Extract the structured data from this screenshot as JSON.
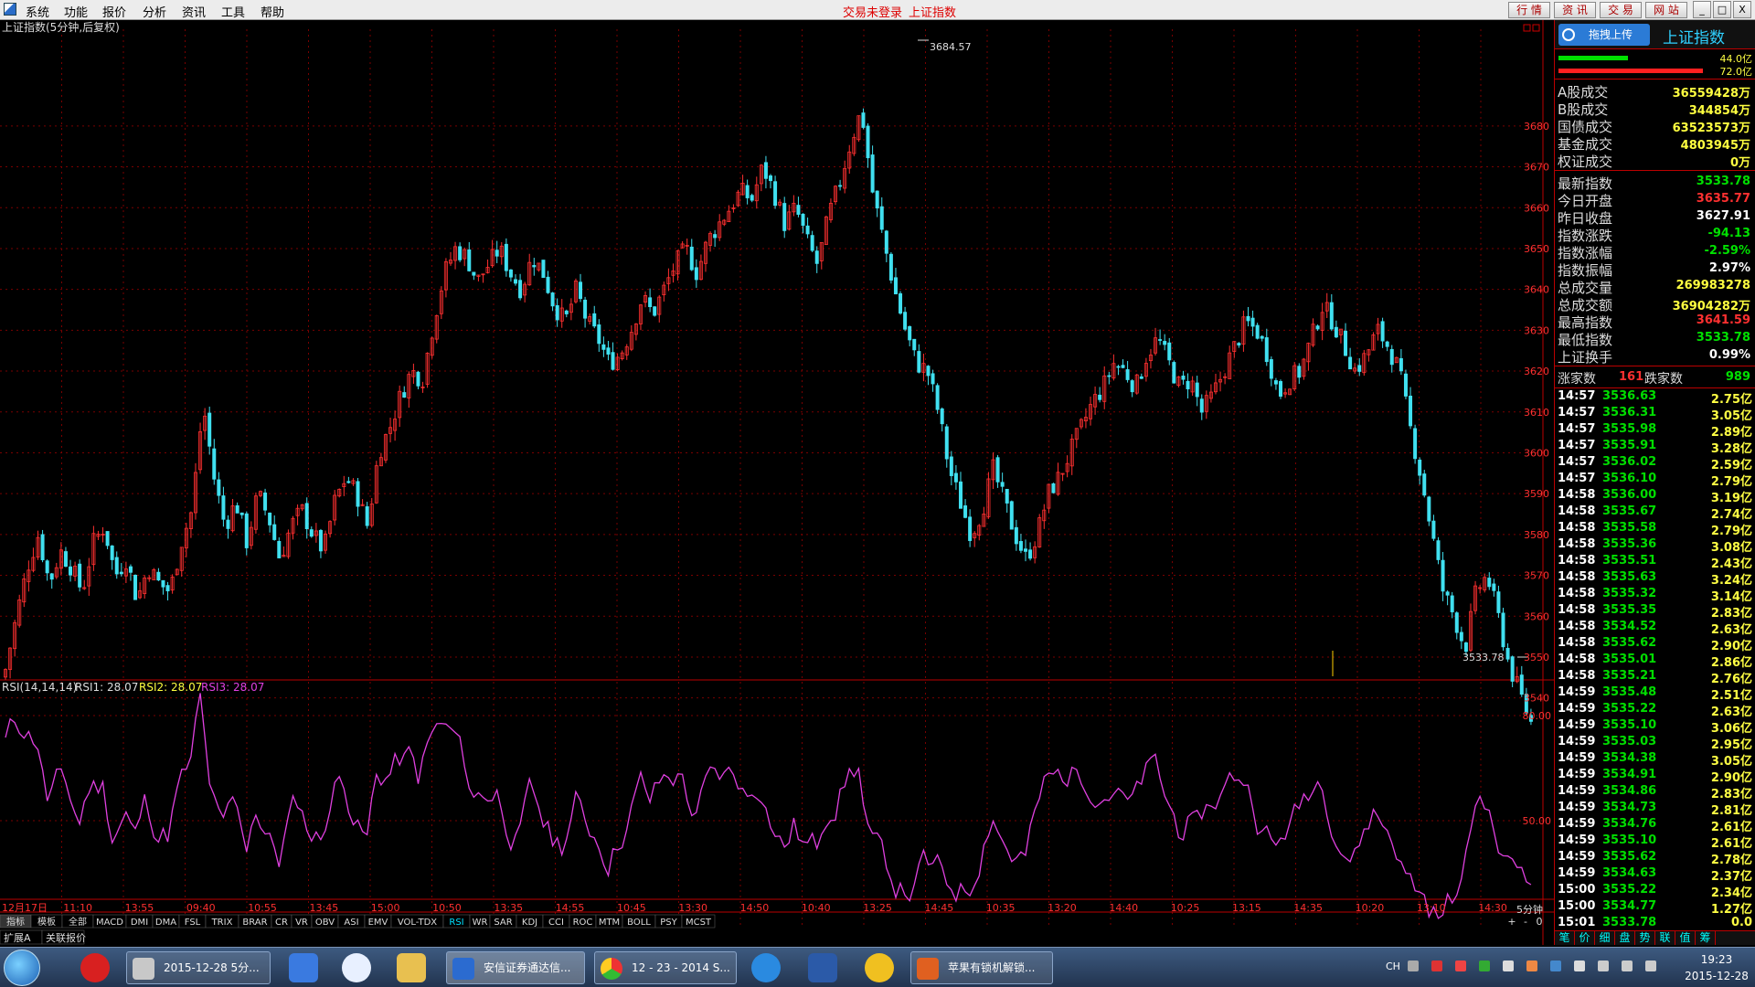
{
  "menu": {
    "items": [
      "系统",
      "功能",
      "报价",
      "分析",
      "资讯",
      "工具",
      "帮助"
    ],
    "login_status": "交易未登录",
    "current_index": "上证指数",
    "right_buttons": [
      "行 情",
      "资 讯",
      "交 易",
      "网 站"
    ],
    "window_controls": [
      "_",
      "□",
      "X"
    ]
  },
  "chart": {
    "title": "上证指数(5分钟,后复权)",
    "high_label": "3684.57",
    "low_label": "3533.78",
    "y_ticks": [
      "3680",
      "3670",
      "3660",
      "3650",
      "3640",
      "3630",
      "3620",
      "3610",
      "3600",
      "3590",
      "3580",
      "3570",
      "3560",
      "3550",
      "3540"
    ],
    "rsi_legend": {
      "name": "RSI(14,14,14)",
      "rsi1": "RSI1: 28.07",
      "rsi2": "RSI2: 28.07",
      "rsi3": "RSI3: 28.07"
    },
    "rsi_ticks": [
      "80.00",
      "50.00"
    ],
    "x_labels": [
      "12月17日",
      "11:10",
      "13:55",
      "09:40",
      "10:55",
      "13:45",
      "15:00",
      "10:50",
      "13:35",
      "14:55",
      "10:45",
      "13:30",
      "14:50",
      "10:40",
      "13:25",
      "14:45",
      "10:35",
      "13:20",
      "14:40",
      "10:25",
      "13:15",
      "14:35",
      "10:20",
      "13:10",
      "14:30"
    ],
    "period": "5分钟",
    "indicator_tabs": [
      "指标",
      "模板",
      "全部",
      "MACD",
      "DMI",
      "DMA",
      "FSL",
      "TRIX",
      "BRAR",
      "CR",
      "VR",
      "OBV",
      "ASI",
      "EMV",
      "VOL-TDX",
      "RSI",
      "WR",
      "SAR",
      "KDJ",
      "CCI",
      "ROC",
      "MTM",
      "BOLL",
      "PSY",
      "MCST"
    ],
    "active_tab": "RSI",
    "scroll_controls": [
      "+",
      "-",
      "0"
    ],
    "bottom_tabs": [
      "扩展A",
      "关联报价"
    ],
    "colors": {
      "up": "#ff3030",
      "down": "#40e0f0",
      "rsi": "#e040e0",
      "grid": "#7a0000"
    }
  },
  "chart_data": [
    {
      "type": "candlestick",
      "title": "上证指数(5分钟,后复权)",
      "ylim": [
        3533.78,
        3684.57
      ],
      "high": 3684.57,
      "low": 3533.78,
      "close_path": [
        3547,
        3560,
        3572,
        3580,
        3568,
        3576,
        3572,
        3566,
        3578,
        3582,
        3570,
        3574,
        3564,
        3572,
        3568,
        3566,
        3578,
        3586,
        3612,
        3594,
        3582,
        3588,
        3578,
        3590,
        3584,
        3574,
        3582,
        3586,
        3580,
        3576,
        3588,
        3594,
        3590,
        3582,
        3600,
        3606,
        3614,
        3620,
        3618,
        3632,
        3644,
        3650,
        3648,
        3642,
        3646,
        3650,
        3644,
        3640,
        3648,
        3644,
        3636,
        3632,
        3640,
        3632,
        3628,
        3622,
        3624,
        3630,
        3638,
        3634,
        3640,
        3646,
        3650,
        3644,
        3652,
        3656,
        3660,
        3664,
        3662,
        3670,
        3664,
        3656,
        3660,
        3652,
        3646,
        3658,
        3666,
        3676,
        3684,
        3664,
        3652,
        3640,
        3630,
        3622,
        3620,
        3610,
        3596,
        3588,
        3580,
        3586,
        3596,
        3588,
        3580,
        3574,
        3580,
        3590,
        3594,
        3600,
        3606,
        3612,
        3616,
        3622,
        3620,
        3616,
        3624,
        3628,
        3622,
        3616,
        3618,
        3610,
        3614,
        3620,
        3626,
        3632,
        3630,
        3624,
        3614,
        3618,
        3620,
        3628,
        3636,
        3632,
        3626,
        3620,
        3624,
        3630,
        3626,
        3620,
        3606,
        3594,
        3580,
        3566,
        3560,
        3552,
        3566,
        3570,
        3560,
        3548,
        3541,
        3534
      ],
      "series": [
        {
          "name": "RSI1",
          "ylim": [
            0,
            100
          ]
        }
      ]
    }
  ],
  "panel": {
    "upload_label": "拖拽上传",
    "title": "上证指数",
    "bars": [
      {
        "value": "44.0亿",
        "color": "#00e000"
      },
      {
        "value": "72.0亿",
        "color": "#ff2020"
      }
    ],
    "volumes": [
      {
        "k": "A股成交",
        "v": "36559428万"
      },
      {
        "k": "B股成交",
        "v": "344854万"
      },
      {
        "k": "国债成交",
        "v": "63523573万"
      },
      {
        "k": "基金成交",
        "v": "4803945万"
      },
      {
        "k": "权证成交",
        "v": "0万"
      }
    ],
    "stats": [
      {
        "k": "最新指数",
        "v": "3533.78",
        "c": "#00e000"
      },
      {
        "k": "今日开盘",
        "v": "3635.77",
        "c": "#ff3030"
      },
      {
        "k": "昨日收盘",
        "v": "3627.91",
        "c": "#ffffff"
      },
      {
        "k": "指数涨跌",
        "v": "-94.13",
        "c": "#00e000"
      },
      {
        "k": "指数涨幅",
        "v": "-2.59%",
        "c": "#00e000"
      },
      {
        "k": "指数振幅",
        "v": "2.97%",
        "c": "#ffffff"
      },
      {
        "k": "总成交量",
        "v": "269983278",
        "c": "#ffff40"
      },
      {
        "k": "总成交额",
        "v": "36904282万",
        "c": "#ffff40"
      },
      {
        "k": "最高指数",
        "v": "3641.59",
        "c": "#ff3030"
      },
      {
        "k": "最低指数",
        "v": "3533.78",
        "c": "#00e000"
      },
      {
        "k": "上证换手",
        "v": "0.99%",
        "c": "#ffffff"
      }
    ],
    "breadth": {
      "up_label": "涨家数",
      "up": "161",
      "down_label": "跌家数",
      "down": "989"
    },
    "ticks": [
      [
        "14:57",
        "3536.63",
        "2.75亿"
      ],
      [
        "14:57",
        "3536.31",
        "3.05亿"
      ],
      [
        "14:57",
        "3535.98",
        "2.89亿"
      ],
      [
        "14:57",
        "3535.91",
        "3.28亿"
      ],
      [
        "14:57",
        "3536.02",
        "2.59亿"
      ],
      [
        "14:57",
        "3536.10",
        "2.79亿"
      ],
      [
        "14:58",
        "3536.00",
        "3.19亿"
      ],
      [
        "14:58",
        "3535.67",
        "2.74亿"
      ],
      [
        "14:58",
        "3535.58",
        "2.79亿"
      ],
      [
        "14:58",
        "3535.36",
        "3.08亿"
      ],
      [
        "14:58",
        "3535.51",
        "2.43亿"
      ],
      [
        "14:58",
        "3535.63",
        "3.24亿"
      ],
      [
        "14:58",
        "3535.32",
        "3.14亿"
      ],
      [
        "14:58",
        "3535.35",
        "2.83亿"
      ],
      [
        "14:58",
        "3534.52",
        "2.63亿"
      ],
      [
        "14:58",
        "3535.62",
        "2.90亿"
      ],
      [
        "14:58",
        "3535.01",
        "2.86亿"
      ],
      [
        "14:58",
        "3535.21",
        "2.76亿"
      ],
      [
        "14:59",
        "3535.48",
        "2.51亿"
      ],
      [
        "14:59",
        "3535.22",
        "2.63亿"
      ],
      [
        "14:59",
        "3535.10",
        "3.06亿"
      ],
      [
        "14:59",
        "3535.03",
        "2.95亿"
      ],
      [
        "14:59",
        "3534.38",
        "3.05亿"
      ],
      [
        "14:59",
        "3534.91",
        "2.90亿"
      ],
      [
        "14:59",
        "3534.86",
        "2.83亿"
      ],
      [
        "14:59",
        "3534.73",
        "2.81亿"
      ],
      [
        "14:59",
        "3534.76",
        "2.61亿"
      ],
      [
        "14:59",
        "3535.10",
        "2.61亿"
      ],
      [
        "14:59",
        "3535.62",
        "2.78亿"
      ],
      [
        "14:59",
        "3534.63",
        "2.37亿"
      ],
      [
        "15:00",
        "3535.22",
        "2.34亿"
      ],
      [
        "15:00",
        "3534.77",
        "1.27亿"
      ],
      [
        "15:01",
        "3533.78",
        "0.0"
      ]
    ],
    "bottom_tabs": [
      "笔",
      "价",
      "细",
      "盘",
      "势",
      "联",
      "值",
      "筹"
    ]
  },
  "taskbar": {
    "items": [
      {
        "label": "2015-12-28  5分...",
        "color": "#c8c8c8"
      },
      {
        "label": "安信证券通达信...",
        "color": "#2b6bd0"
      },
      {
        "label": "12 - 23 - 2014 S...",
        "color": "#e0a020"
      },
      {
        "label": "苹果有锁机解锁...",
        "color": "#e06020"
      }
    ],
    "lang": "CH",
    "time": "19:23",
    "date": "2015-12-28"
  }
}
